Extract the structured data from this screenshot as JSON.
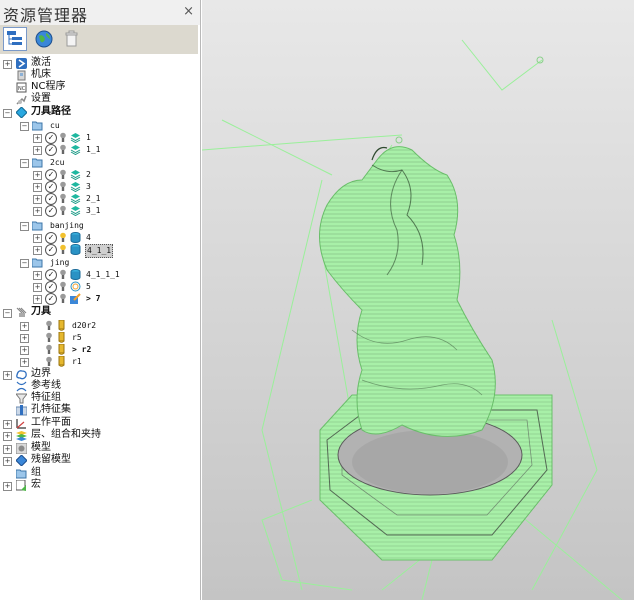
{
  "panel": {
    "title": "资源管理器",
    "close": "×"
  },
  "tree": {
    "activate": "激活",
    "machine": "机床",
    "nc_program": "NC程序",
    "settings": "设置",
    "toolpaths": "刀具路径",
    "cu": "cu",
    "tp_1": "1",
    "tp_1_1": "1_1",
    "cu2": "2cu",
    "tp_2": "2",
    "tp_3": "3",
    "tp_2_1": "2_1",
    "tp_3_1": "3_1",
    "banjing": "banjing",
    "tp_4": "4",
    "tp_4_1_1": "4_1_1",
    "jing": "jing",
    "tp_4_1_1_1": "4_1_1_1",
    "tp_5": "5",
    "tp_7": "> 7",
    "tools": "刀具",
    "tool_d20r2": "d20r2",
    "tool_r5": "r5",
    "tool_r2": "> r2",
    "tool_r1": "r1",
    "boundary": "边界",
    "reference_line": "参考线",
    "feature_group": "特征组",
    "hole_feature_set": "孔特征集",
    "workplane": "工作平面",
    "layers": "层、组合和夹持",
    "model": "模型",
    "residual_model": "残留模型",
    "group": "组",
    "macro": "宏"
  },
  "colors": {
    "toolpath_green": "#a8f0a8",
    "background_top": "#e8e8e8",
    "background_bottom": "#c4c4c4",
    "accent_blue": "#2f6fc0"
  }
}
